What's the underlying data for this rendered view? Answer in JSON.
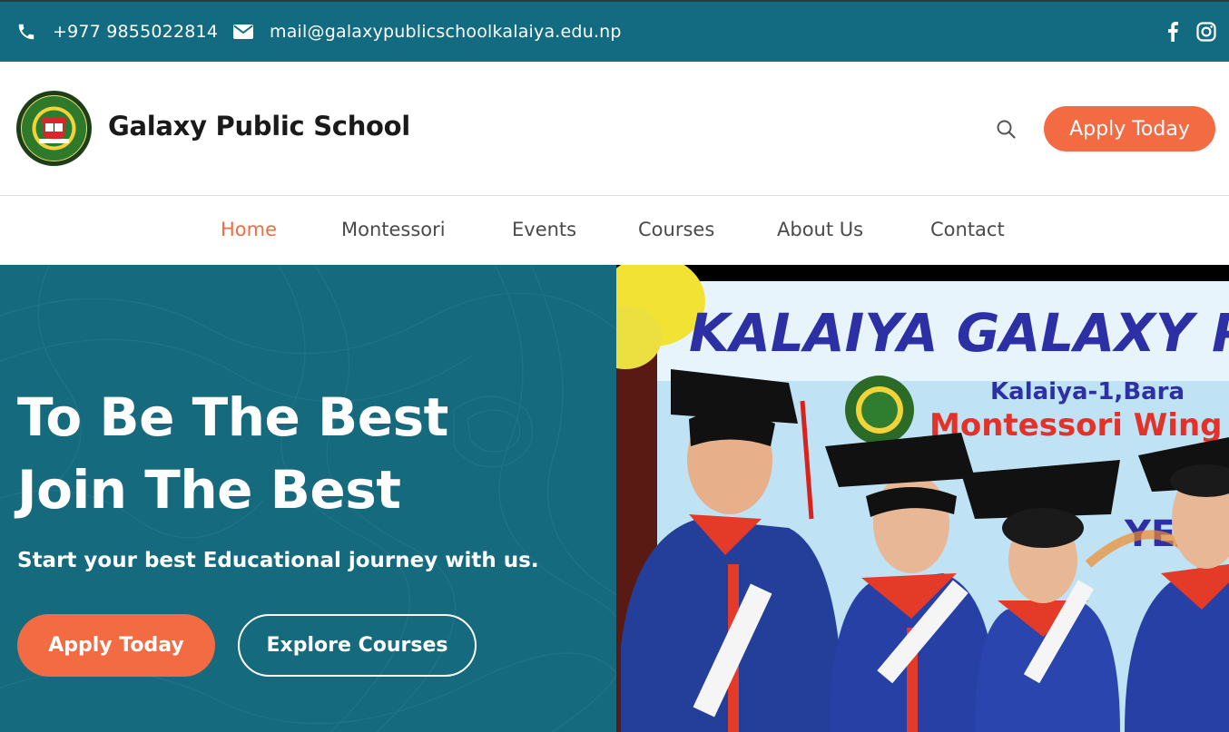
{
  "topbar": {
    "phone": "+977 9855022814",
    "email": "mail@galaxypublicschoolkalaiya.edu.np",
    "social_icons": [
      "facebook-icon",
      "instagram-icon"
    ]
  },
  "header": {
    "site_name": "Galaxy Public School",
    "apply_label": "Apply Today",
    "logo_text": "KALAIYA GALAXY PUBLIC SCHOOL PVT. LTD. KALAIYA-01, BARA"
  },
  "nav": {
    "items": [
      {
        "label": "Home",
        "active": true
      },
      {
        "label": "Montessori",
        "active": false
      },
      {
        "label": "Events",
        "active": false
      },
      {
        "label": "Courses",
        "active": false
      },
      {
        "label": "About Us",
        "active": false
      },
      {
        "label": "Contact",
        "active": false
      }
    ]
  },
  "hero": {
    "headline_line1": "To Be The Best",
    "headline_line2": "Join The Best",
    "subline": "Start your best Educational journey with us.",
    "apply_label": "Apply Today",
    "explore_label": "Explore Courses",
    "photo": {
      "banner_title": "KALAIYA GALAXY PUBLIC",
      "banner_sub1": "Kalaiya-1,Bara",
      "banner_sub2": "Montessori Wing",
      "banner_year": "YEAR"
    }
  },
  "colors": {
    "topbar_bg": "#126b80",
    "hero_bg": "#166a7d",
    "accent": "#f26b43",
    "active_nav": "#f26b43"
  }
}
